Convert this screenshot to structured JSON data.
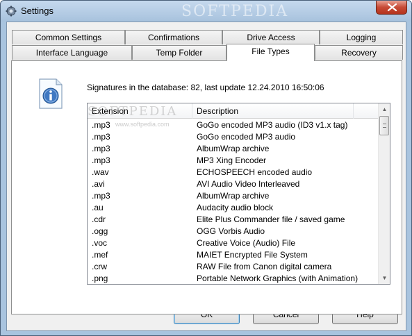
{
  "window": {
    "title": "Settings",
    "watermark": "SOFTPEDIA"
  },
  "tabs": {
    "row1": [
      {
        "label": "Common Settings"
      },
      {
        "label": "Confirmations"
      },
      {
        "label": "Drive Access"
      },
      {
        "label": "Logging"
      }
    ],
    "row2": [
      {
        "label": "Interface Language"
      },
      {
        "label": "Temp Folder"
      },
      {
        "label": "File Types",
        "active": true
      },
      {
        "label": "Recovery"
      }
    ]
  },
  "file_types": {
    "signatures_text": "Signatures in the database: 82, last update 12.24.2010 16:50:06",
    "columns": [
      "Extension",
      "Description"
    ],
    "list_watermark": "SOFTPEDIA",
    "list_watermark_url": "www.softpedia.com",
    "rows": [
      {
        "ext": ".mp3",
        "desc": "GoGo encoded MP3 audio (ID3 v1.x tag)"
      },
      {
        "ext": ".mp3",
        "desc": "GoGo encoded MP3 audio"
      },
      {
        "ext": ".mp3",
        "desc": "AlbumWrap archive"
      },
      {
        "ext": ".mp3",
        "desc": "MP3 Xing Encoder"
      },
      {
        "ext": ".wav",
        "desc": "ECHOSPEECH encoded audio"
      },
      {
        "ext": ".avi",
        "desc": "AVI Audio Video Interleaved"
      },
      {
        "ext": ".mp3",
        "desc": "AlbumWrap archive"
      },
      {
        "ext": ".au",
        "desc": "Audacity audio block"
      },
      {
        "ext": ".cdr",
        "desc": "Elite Plus Commander file / saved game"
      },
      {
        "ext": ".ogg",
        "desc": "OGG Vorbis Audio"
      },
      {
        "ext": ".voc",
        "desc": "Creative Voice (Audio) File"
      },
      {
        "ext": ".mef",
        "desc": "MAIET Encrypted File System"
      },
      {
        "ext": ".crw",
        "desc": "RAW File from Canon digital camera"
      },
      {
        "ext": ".png",
        "desc": "Portable Network Graphics (with Animation)"
      }
    ]
  },
  "buttons": {
    "ok": "OK",
    "cancel": "Cancel",
    "help": "Help"
  },
  "icons": {
    "app": "settings-app-icon",
    "info": "info-icon",
    "close": "close-icon"
  },
  "colors": {
    "title_bar": "#a9c4df",
    "close_button": "#c74a36",
    "default_button_border": "#3c7fb1"
  }
}
